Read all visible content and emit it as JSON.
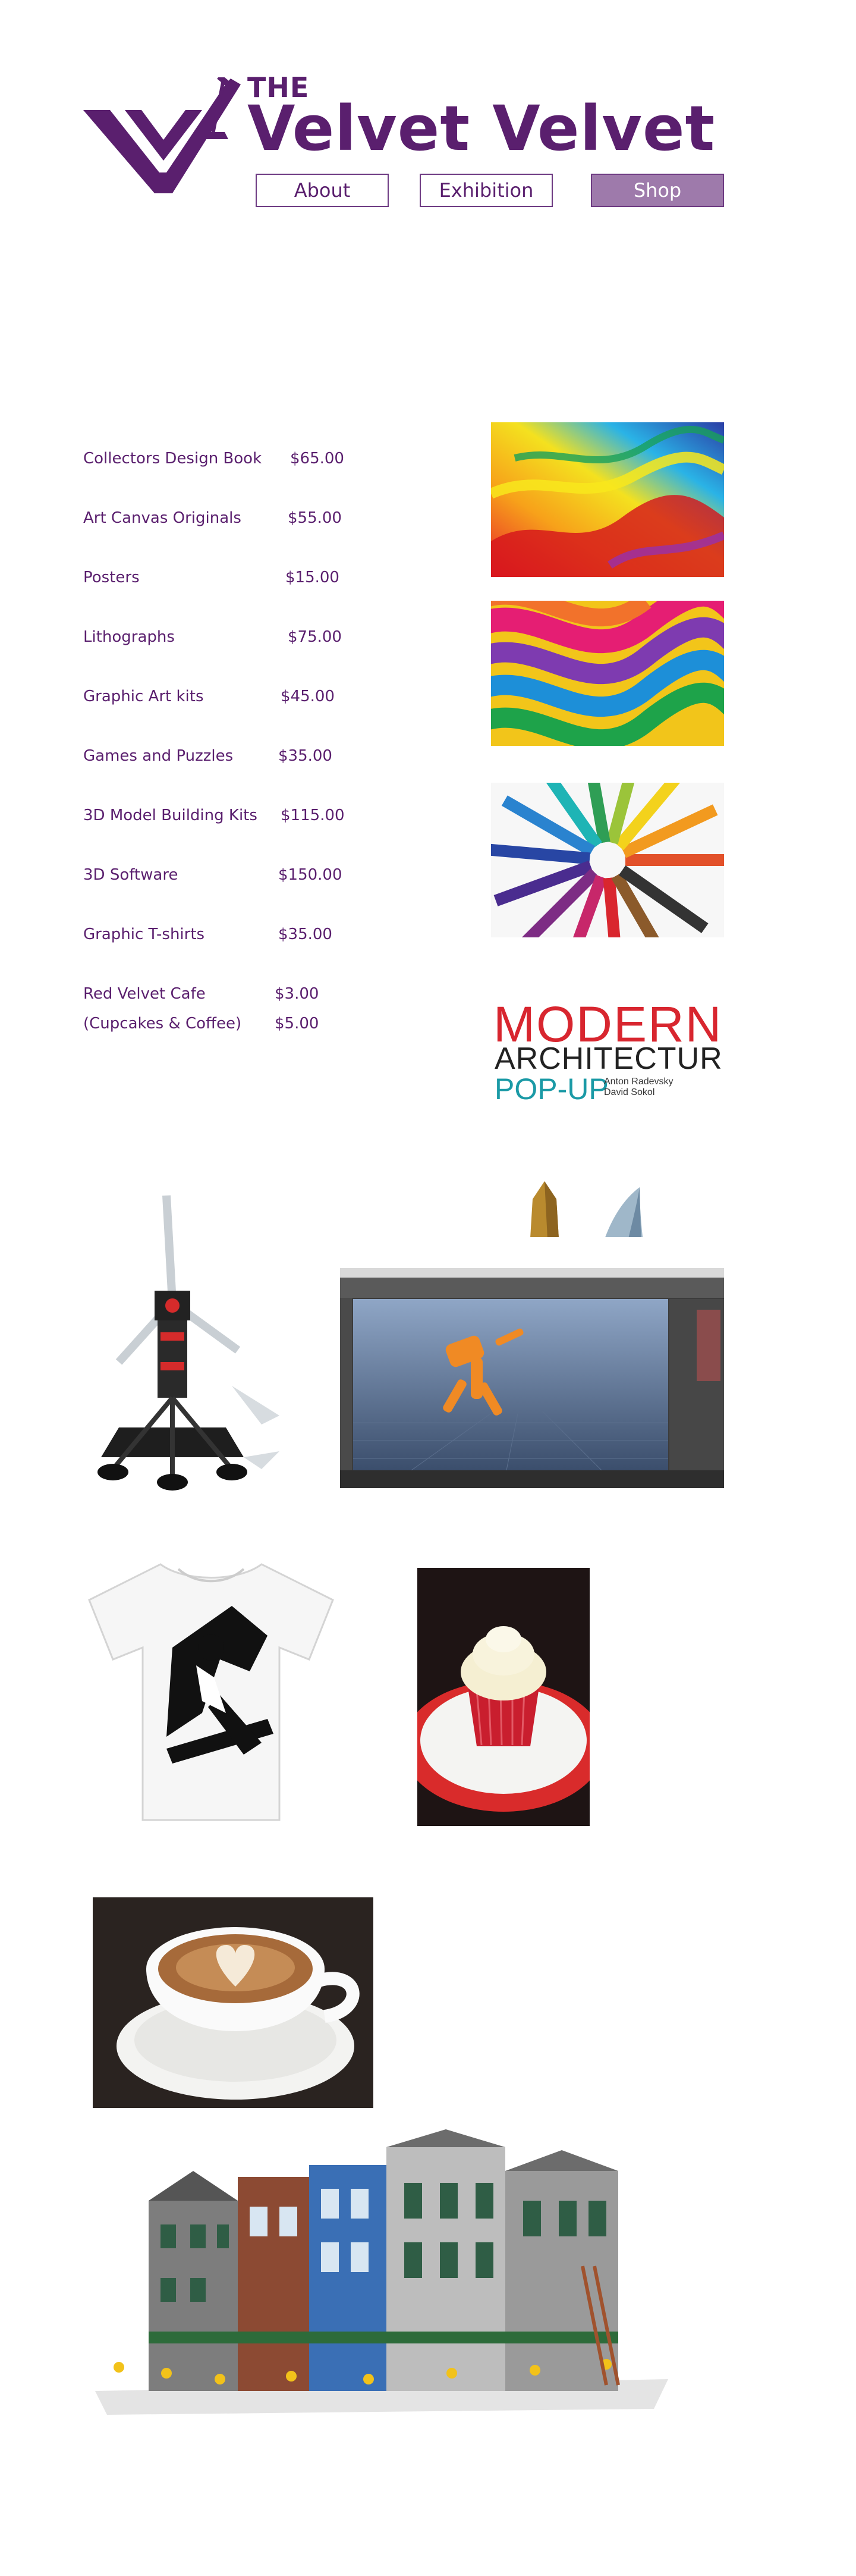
{
  "brand": {
    "the": "THE",
    "name": "Velvet Velvet",
    "color": "#5a1f6e"
  },
  "nav": [
    {
      "label": "About",
      "active": false
    },
    {
      "label": "Exhibition",
      "active": false
    },
    {
      "label": "Shop",
      "active": true
    }
  ],
  "products": [
    {
      "name": "Collectors Design Book",
      "price": "$65.00"
    },
    {
      "name": "Art Canvas Originals",
      "price": "$55.00"
    },
    {
      "name": "Posters",
      "price": "$15.00"
    },
    {
      "name": "Lithographs",
      "price": "$75.00"
    },
    {
      "name": "Graphic Art kits",
      "price": "$45.00"
    },
    {
      "name": "Games and Puzzles",
      "price": "$35.00"
    },
    {
      "name": "3D Model Building Kits",
      "price": "$115.00"
    },
    {
      "name": "3D Software",
      "price": "$150.00"
    },
    {
      "name": "Graphic T-shirts",
      "price": "$35.00"
    },
    {
      "name": "Red Velvet Cafe",
      "price": "$3.00"
    },
    {
      "name": "(Cupcakes & Coffee)",
      "price": "$5.00"
    }
  ],
  "book_cover": {
    "line1": "MODERN",
    "line2": "ARCHITECTURE",
    "line3": "POP-UP",
    "author1": "Anton Radevsky",
    "author2": "David Sokol"
  },
  "images": [
    {
      "icon": "paint-splash-image"
    },
    {
      "icon": "color-swirl-image"
    },
    {
      "icon": "colored-pencils-image"
    },
    {
      "icon": "architecture-book-image"
    },
    {
      "icon": "robot-model-image"
    },
    {
      "icon": "3d-software-screenshot-image"
    },
    {
      "icon": "graphic-tshirt-image"
    },
    {
      "icon": "cupcake-image"
    },
    {
      "icon": "coffee-cup-image"
    },
    {
      "icon": "lego-building-image"
    }
  ]
}
